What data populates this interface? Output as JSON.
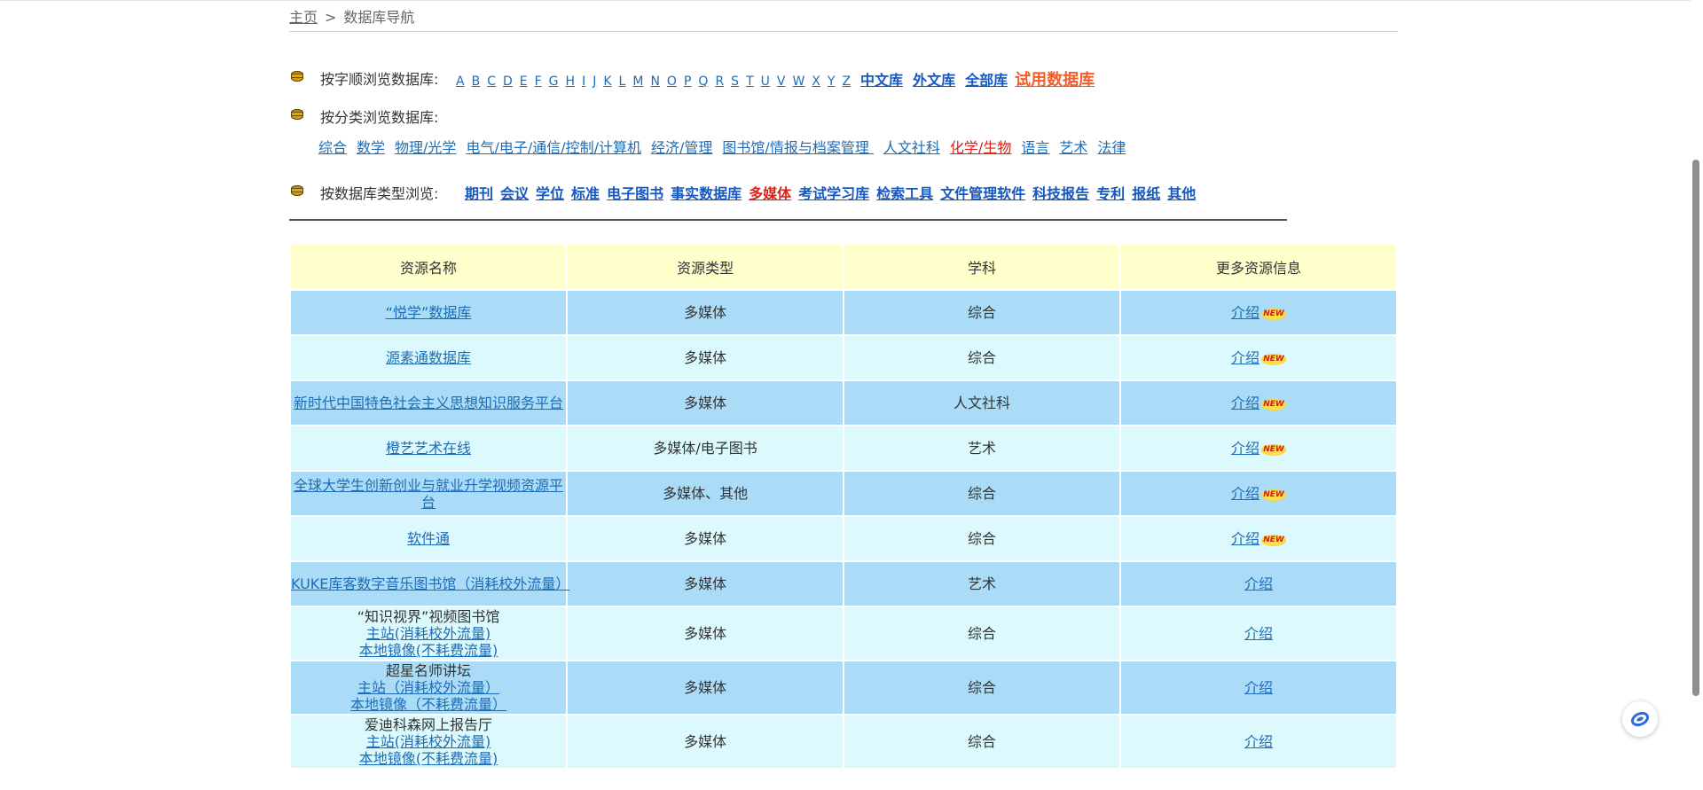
{
  "breadcrumb": {
    "home": "主页",
    "sep": ">",
    "current": "数据库导航"
  },
  "letters_row": {
    "label": "按字顺浏览数据库:",
    "letters": [
      "A",
      "B",
      "C",
      "D",
      "E",
      "F",
      "G",
      "H",
      "I",
      "J",
      "K",
      "L",
      "M",
      "N",
      "O",
      "P",
      "Q",
      "R",
      "S",
      "T",
      "U",
      "V",
      "W",
      "X",
      "Y",
      "Z"
    ],
    "zh_db": "中文库",
    "foreign_db": "外文库",
    "all_db": "全部库",
    "trial_db": "试用数据库"
  },
  "category_row": {
    "label": "按分类浏览数据库:",
    "items": [
      "综合",
      "数学",
      "物理/光学",
      "电气/电子/通信/控制/计算机",
      "经济/管理",
      "图书馆/情报与档案管理 ",
      "人文社科",
      "化学/生物",
      "语言",
      "艺术",
      "法律"
    ]
  },
  "type_row": {
    "label": "按数据库类型浏览:",
    "items": [
      "期刊",
      "会议",
      "学位",
      "标准",
      "电子图书",
      "事实数据库",
      "多媒体",
      "考试学习库",
      "检索工具",
      "文件管理软件",
      "科技报告",
      "专利",
      "报纸",
      "其他"
    ]
  },
  "table": {
    "headers": [
      "资源名称",
      "资源类型",
      "学科",
      "更多资源信息"
    ],
    "rows": [
      {
        "name": "“悦学”数据库",
        "type": "多媒体",
        "subject": "综合",
        "info": "介绍",
        "badge": "NEW"
      },
      {
        "name": "源素通数据库",
        "type": "多媒体",
        "subject": "综合",
        "info": "介绍",
        "badge": "NEW"
      },
      {
        "name": "新时代中国特色社会主义思想知识服务平台",
        "type": "多媒体",
        "subject": "人文社科",
        "info": "介绍",
        "badge": "NEW"
      },
      {
        "name": "橙艺艺术在线",
        "type": "多媒体/电子图书",
        "subject": "艺术",
        "info": "介绍",
        "badge": "NEW"
      },
      {
        "name": "全球大学生创新创业与就业升学视频资源平台",
        "type": "多媒体、其他",
        "subject": "综合",
        "info": "介绍",
        "badge": "NEW"
      },
      {
        "name": "软件通",
        "type": "多媒体",
        "subject": "综合",
        "info": "介绍",
        "badge": "NEW"
      },
      {
        "name": "KUKE库客数字音乐图书馆（消耗校外流量）",
        "type": "多媒体",
        "subject": "艺术",
        "info": "介绍"
      },
      {
        "name": "“知识视界”视频图书馆",
        "main_link": "主站(消耗校外流量)",
        "mirror_link": "本地镜像(不耗费流量)",
        "type": "多媒体",
        "subject": "综合",
        "info": "介绍"
      },
      {
        "name": "超星名师讲坛",
        "main_link": "主站（消耗校外流量）",
        "mirror_link": "本地镜像（不耗费流量）",
        "type": "多媒体",
        "subject": "综合",
        "info": "介绍"
      },
      {
        "name": "爱迪科森网上报告厅",
        "main_link": "主站(消耗校外流量)",
        "mirror_link": "本地镜像(不耗费流量)",
        "type": "多媒体",
        "subject": "综合",
        "info": "介绍"
      }
    ]
  }
}
